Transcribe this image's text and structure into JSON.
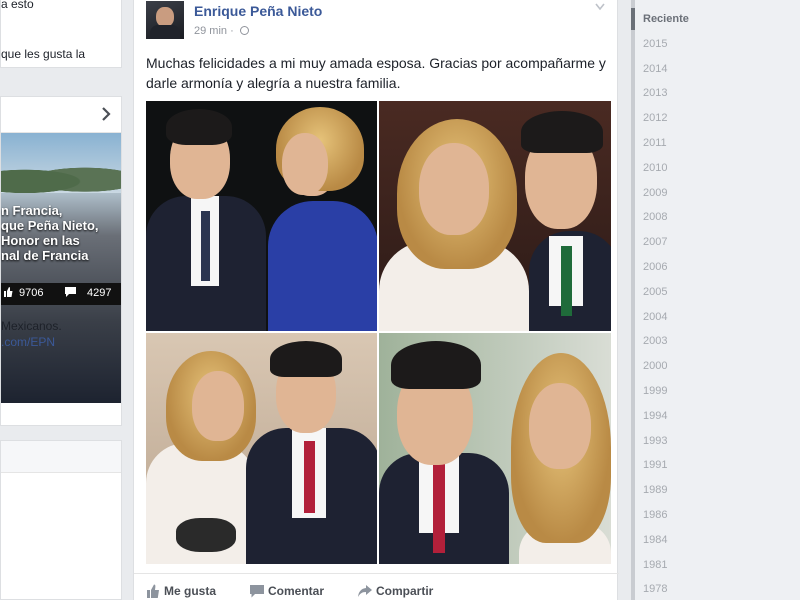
{
  "left": {
    "top_lines": [
      "a esto",
      "que les gusta la"
    ],
    "video": {
      "overlay_lines": [
        "n Francia,",
        "que Peña Nieto,",
        "Honor en las",
        "nal de Francia"
      ],
      "likes": "9706",
      "comments": "4297"
    },
    "links": [
      "Mexicanos.",
      ".com/EPN"
    ]
  },
  "post": {
    "author": "Enrique Peña Nieto",
    "time": "29 min",
    "text": "Muchas felicidades a mi muy amada esposa. Gracias por acompañarme y darle armonía y alegría a nuestra familia.",
    "actions": {
      "like": "Me gusta",
      "comment": "Comentar",
      "share": "Compartir"
    }
  },
  "timeline": {
    "items": [
      "Reciente",
      "2015",
      "2014",
      "2013",
      "2012",
      "2011",
      "2010",
      "2009",
      "2008",
      "2007",
      "2006",
      "2005",
      "2004",
      "2003",
      "2000",
      "1999",
      "1994",
      "1993",
      "1991",
      "1989",
      "1986",
      "1984",
      "1981",
      "1978"
    ]
  }
}
